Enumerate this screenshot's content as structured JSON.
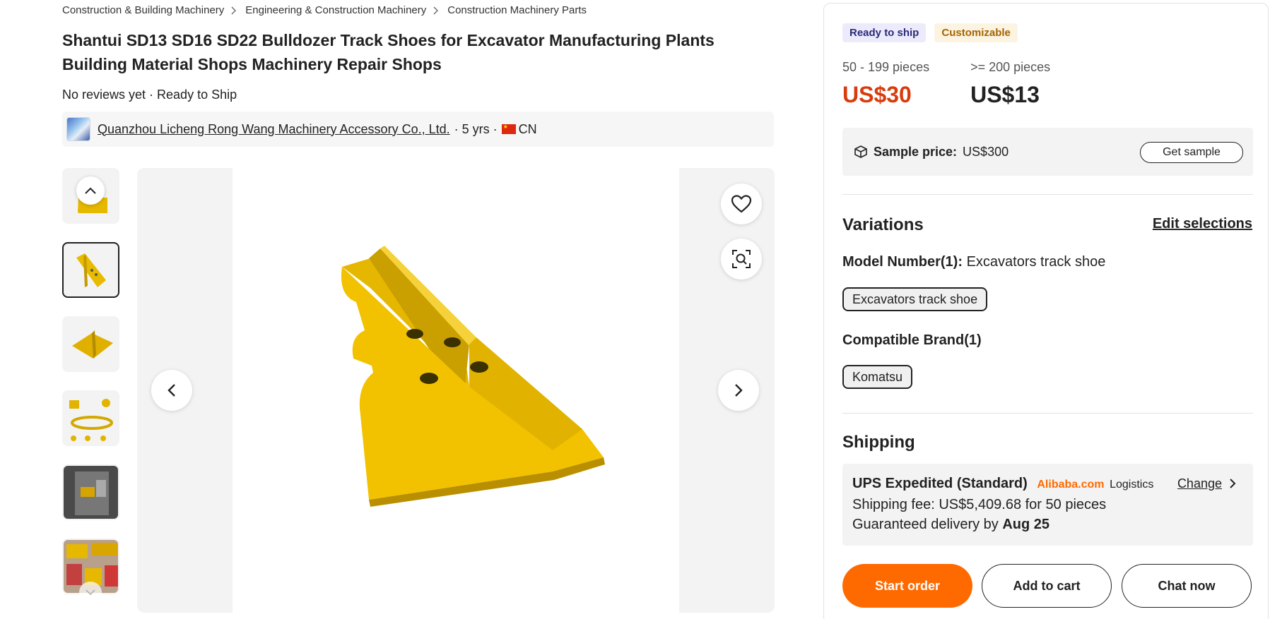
{
  "breadcrumb": [
    "Construction & Building Machinery",
    "Engineering & Construction Machinery",
    "Construction Machinery Parts"
  ],
  "title": "Shantui SD13 SD16 SD22 Bulldozer Track Shoes for Excavator Manufacturing Plants Building Material Shops Machinery Repair Shops",
  "meta": "No reviews yet · Ready to Ship",
  "supplier": {
    "name": "Quanzhou Licheng Rong Wang Machinery Accessory Co., Ltd.",
    "years": "· 5 yrs ·",
    "country": "CN"
  },
  "badges": {
    "ship": "Ready to ship",
    "custom": "Customizable"
  },
  "tiers": [
    {
      "qty": "50 - 199 pieces",
      "price": "US$30"
    },
    {
      "qty": ">= 200 pieces",
      "price": "US$13"
    }
  ],
  "sample": {
    "label": "Sample price:",
    "price": "US$300",
    "button": "Get sample"
  },
  "variations": {
    "title": "Variations",
    "edit": "Edit selections",
    "model_label": "Model Number(1):",
    "model_value": "Excavators track shoe",
    "model_chip": "Excavators track shoe",
    "brand_label": "Compatible Brand(1)",
    "brand_chip": "Komatsu"
  },
  "shipping": {
    "title": "Shipping",
    "carrier": "UPS Expedited (Standard)",
    "logo_text": "Alibaba.com",
    "logistics": "Logistics",
    "change": "Change",
    "fee": "Shipping fee: US$5,409.68 for 50 pieces",
    "delivery_prefix": "Guaranteed delivery by ",
    "delivery_date": "Aug 25"
  },
  "actions": {
    "start": "Start order",
    "cart": "Add to cart",
    "chat": "Chat now"
  },
  "colors": {
    "accent": "#ff6a00",
    "price": "#d83c0c",
    "product": "#f2c200"
  }
}
